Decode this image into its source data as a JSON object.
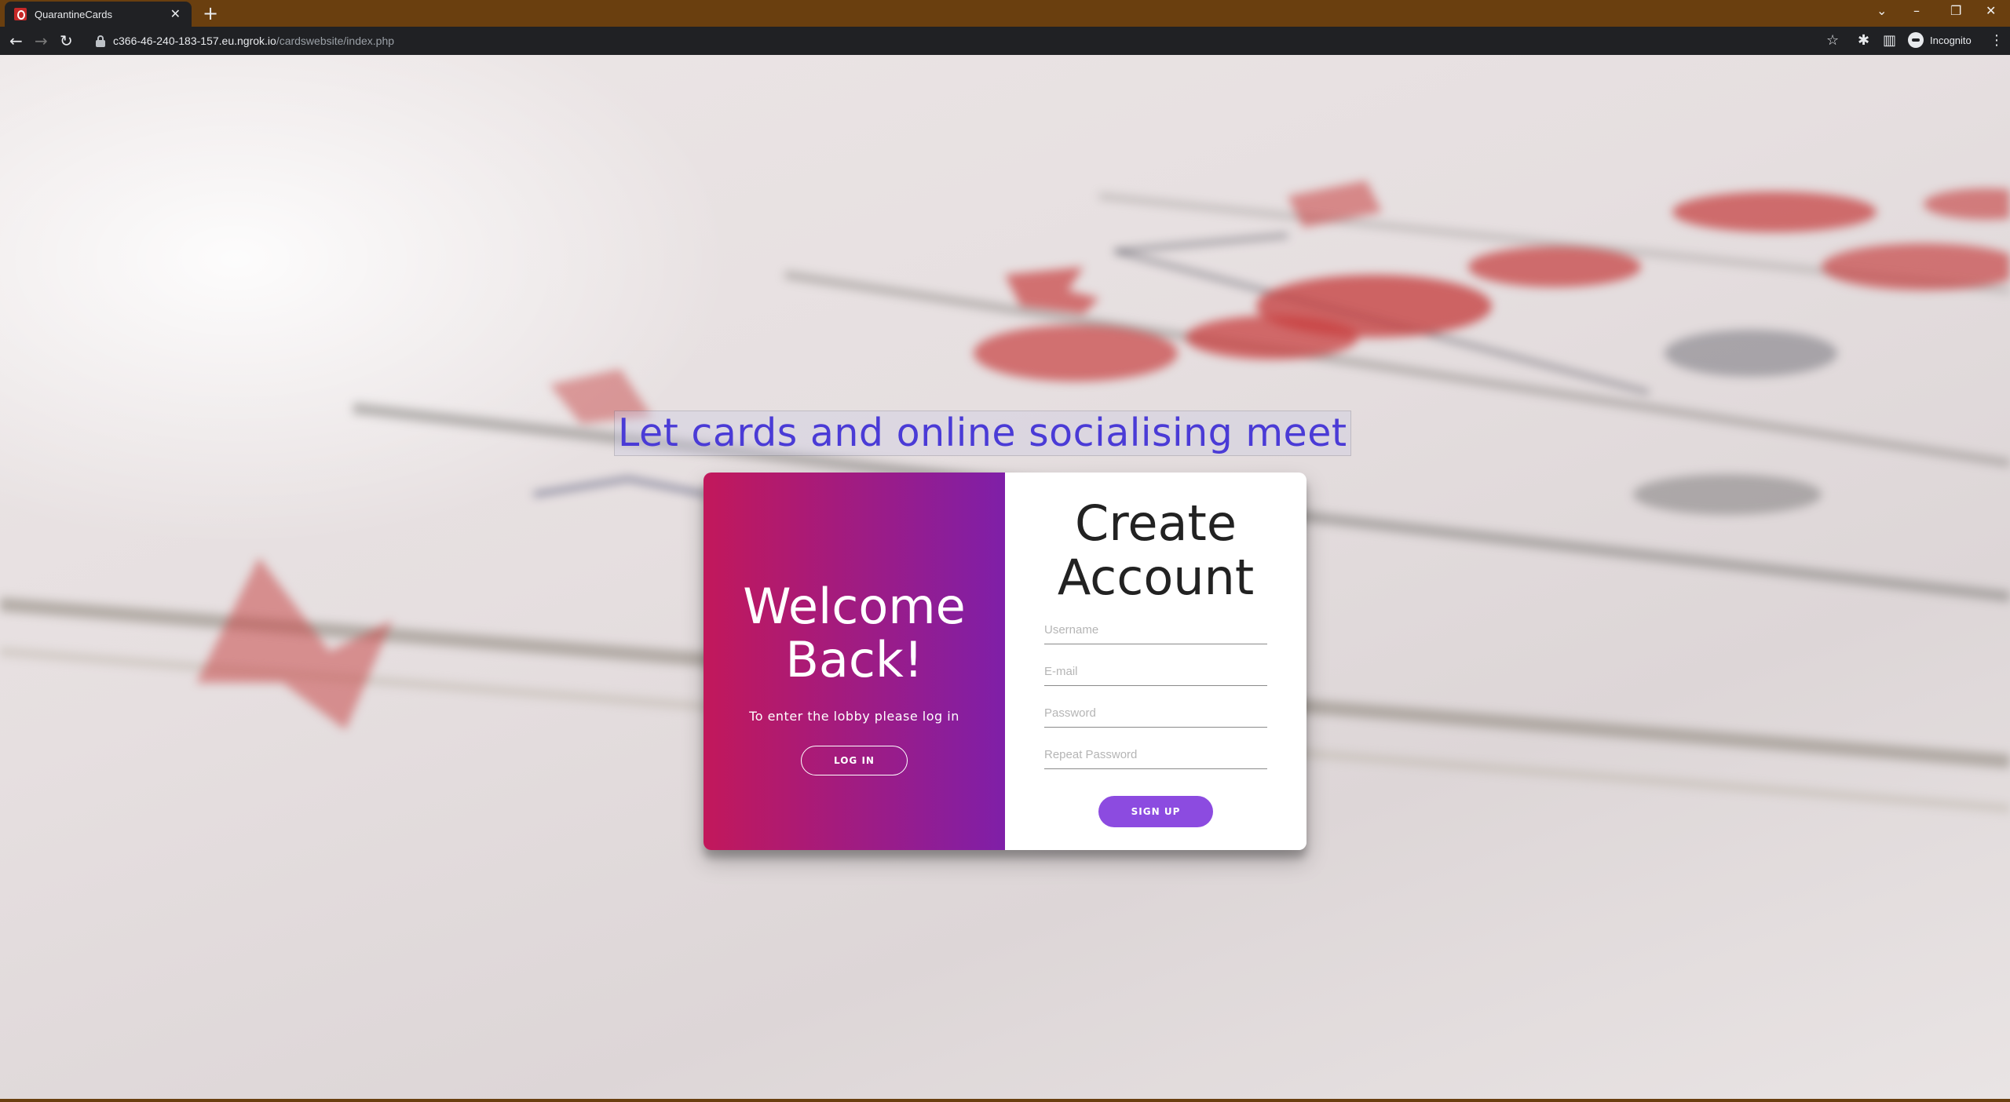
{
  "browser": {
    "tab_title": "QuarantineCards",
    "tab_close": "✕",
    "new_tab": "+",
    "url_host": "c366-46-240-183-157.eu.ngrok.io",
    "url_path": "/cardswebsite/index.php",
    "profile_label": "Incognito",
    "icons": {
      "back": "back-arrow-icon",
      "forward": "forward-arrow-icon",
      "reload": "reload-icon",
      "bookmark": "star-icon",
      "extensions": "puzzle-icon",
      "side_panel": "side-panel-icon",
      "menu": "kebab-menu-icon"
    },
    "colors": {
      "frame": "#6a3f0f",
      "toolbar": "#202124"
    }
  },
  "page": {
    "tagline": "Let cards and online socialising meet",
    "welcome": {
      "title": "Welcome Back!",
      "text": "To enter the lobby please log in",
      "login_button": "LOG IN"
    },
    "signup": {
      "title": "Create Account",
      "fields": {
        "username": {
          "placeholder": "Username",
          "value": ""
        },
        "email": {
          "placeholder": "E-mail",
          "value": ""
        },
        "password": {
          "placeholder": "Password",
          "value": ""
        },
        "repeat_password": {
          "placeholder": "Repeat Password",
          "value": ""
        }
      },
      "signup_button": "SIGN UP"
    },
    "colors": {
      "gradient_start": "#c2185b",
      "gradient_end": "#7f1fa8",
      "primary_button": "#8c4be0",
      "tagline": "#4a3bd6"
    }
  }
}
